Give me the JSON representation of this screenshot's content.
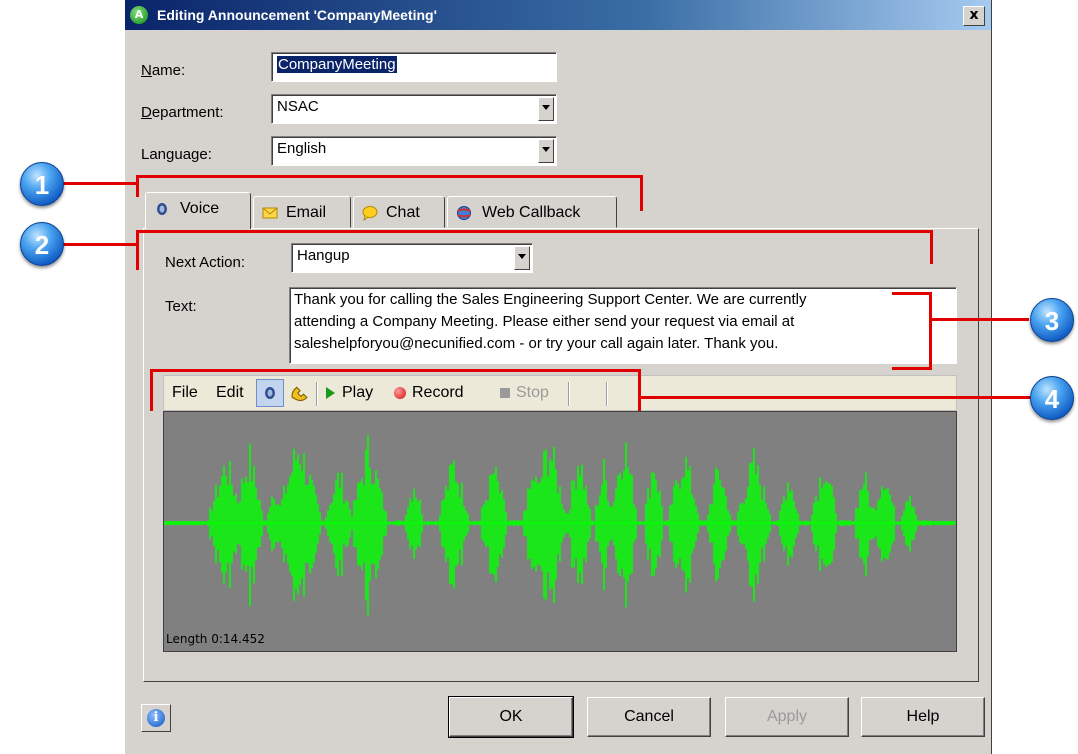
{
  "window": {
    "title": "Editing Announcement 'CompanyMeeting'",
    "close_label": "x"
  },
  "form": {
    "name_label": "Name:",
    "name_value": "CompanyMeeting",
    "department_label": "Department:",
    "department_value": "NSAC",
    "language_label": "Language:",
    "language_value": "English"
  },
  "tabs": [
    {
      "label": "Voice",
      "icon": "speaker-icon",
      "active": true
    },
    {
      "label": "Email",
      "icon": "envelope-icon"
    },
    {
      "label": "Chat",
      "icon": "chat-bubble-icon"
    },
    {
      "label": "Web Callback",
      "icon": "globe-phone-icon"
    }
  ],
  "voice": {
    "next_action_label": "Next Action:",
    "next_action_value": "Hangup",
    "text_label": "Text:",
    "text_lines": [
      "Thank you for calling the Sales Engineering Support Center.  We are currently",
      "attending a Company Meeting.  Please either send your request via email at",
      "saleshelpforyou@necunified.com - or try your call again later.  Thank you."
    ]
  },
  "toolbar": {
    "file": "File",
    "edit": "Edit",
    "play": "Play",
    "record": "Record",
    "stop": "Stop"
  },
  "waveform": {
    "length_label": "Length 0:14.452",
    "color": "#00ff00",
    "background": "#808080"
  },
  "buttons": {
    "ok": "OK",
    "cancel": "Cancel",
    "apply": "Apply",
    "help": "Help"
  },
  "callouts": [
    "1",
    "2",
    "3",
    "4"
  ],
  "colors": {
    "callout_line": "#e00000",
    "dialog_bg": "#d6d3ce",
    "title_bar": "#0a246a"
  }
}
